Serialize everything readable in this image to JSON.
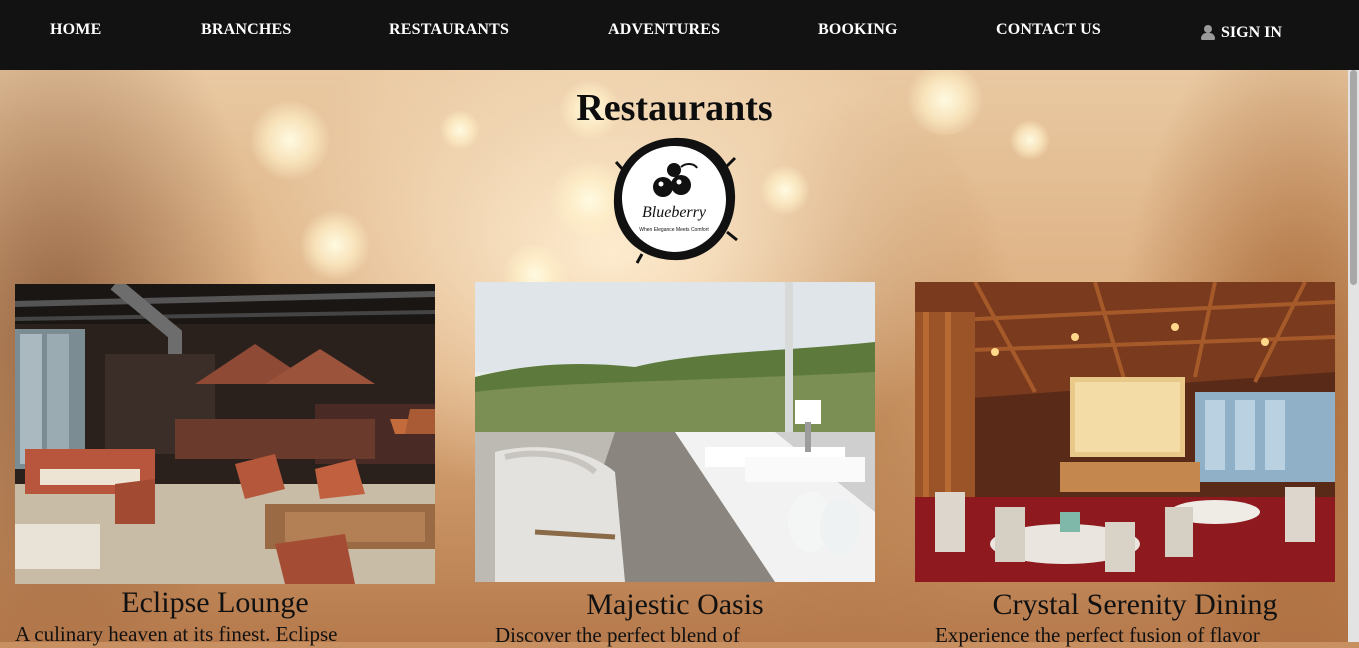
{
  "nav": {
    "items": [
      {
        "label": "HOME"
      },
      {
        "label": "BRANCHES"
      },
      {
        "label": "RESTAURANTS"
      },
      {
        "label": "ADVENTURES"
      },
      {
        "label": "BOOKING"
      },
      {
        "label": "CONTACT US"
      }
    ],
    "signin": {
      "label": "SIGN IN",
      "icon": "user-icon"
    }
  },
  "page": {
    "title": "Restaurants"
  },
  "logo": {
    "name": "Blueberry",
    "tagline": "When Elegance Meets Comfort"
  },
  "restaurants": [
    {
      "name": "Eclipse Lounge",
      "desc": "A culinary heaven at its finest. Eclipse"
    },
    {
      "name": "Majestic Oasis",
      "desc": "Discover the perfect blend of"
    },
    {
      "name": "Crystal Serenity Dining",
      "desc": "Experience the perfect fusion of flavor"
    }
  ],
  "colors": {
    "nav_bg": "#121212",
    "nav_text": "#ffffff",
    "title": "#0d0d0d"
  }
}
